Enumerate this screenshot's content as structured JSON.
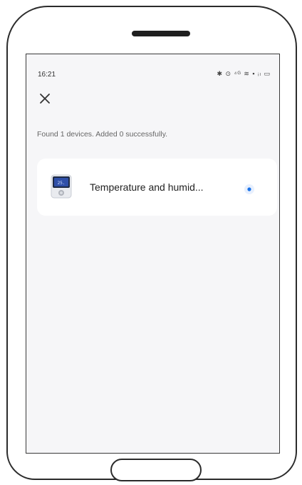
{
  "status_bar": {
    "time": "16:21",
    "icons_text": "✱ ⊙ ⁴ᴳ ≋ ▪ ᵢₗ ▭",
    "icon_names": [
      "bluetooth-icon",
      "alarm-icon",
      "lte-icon",
      "wifi-icon",
      "nfc-icon",
      "signal-icon",
      "battery-icon"
    ]
  },
  "header": {
    "close_icon": "close-icon"
  },
  "scan": {
    "summary": "Found 1 devices. Added 0 successfully."
  },
  "devices": [
    {
      "name": "Temperature and humid...",
      "icon": "thermometer-hygrometer-device-icon",
      "status": "adding"
    }
  ],
  "colors": {
    "accent": "#1a73e8",
    "screen_background": "#f6f6f8",
    "card_background": "#ffffff",
    "device_screen": "#2f4fa8"
  }
}
